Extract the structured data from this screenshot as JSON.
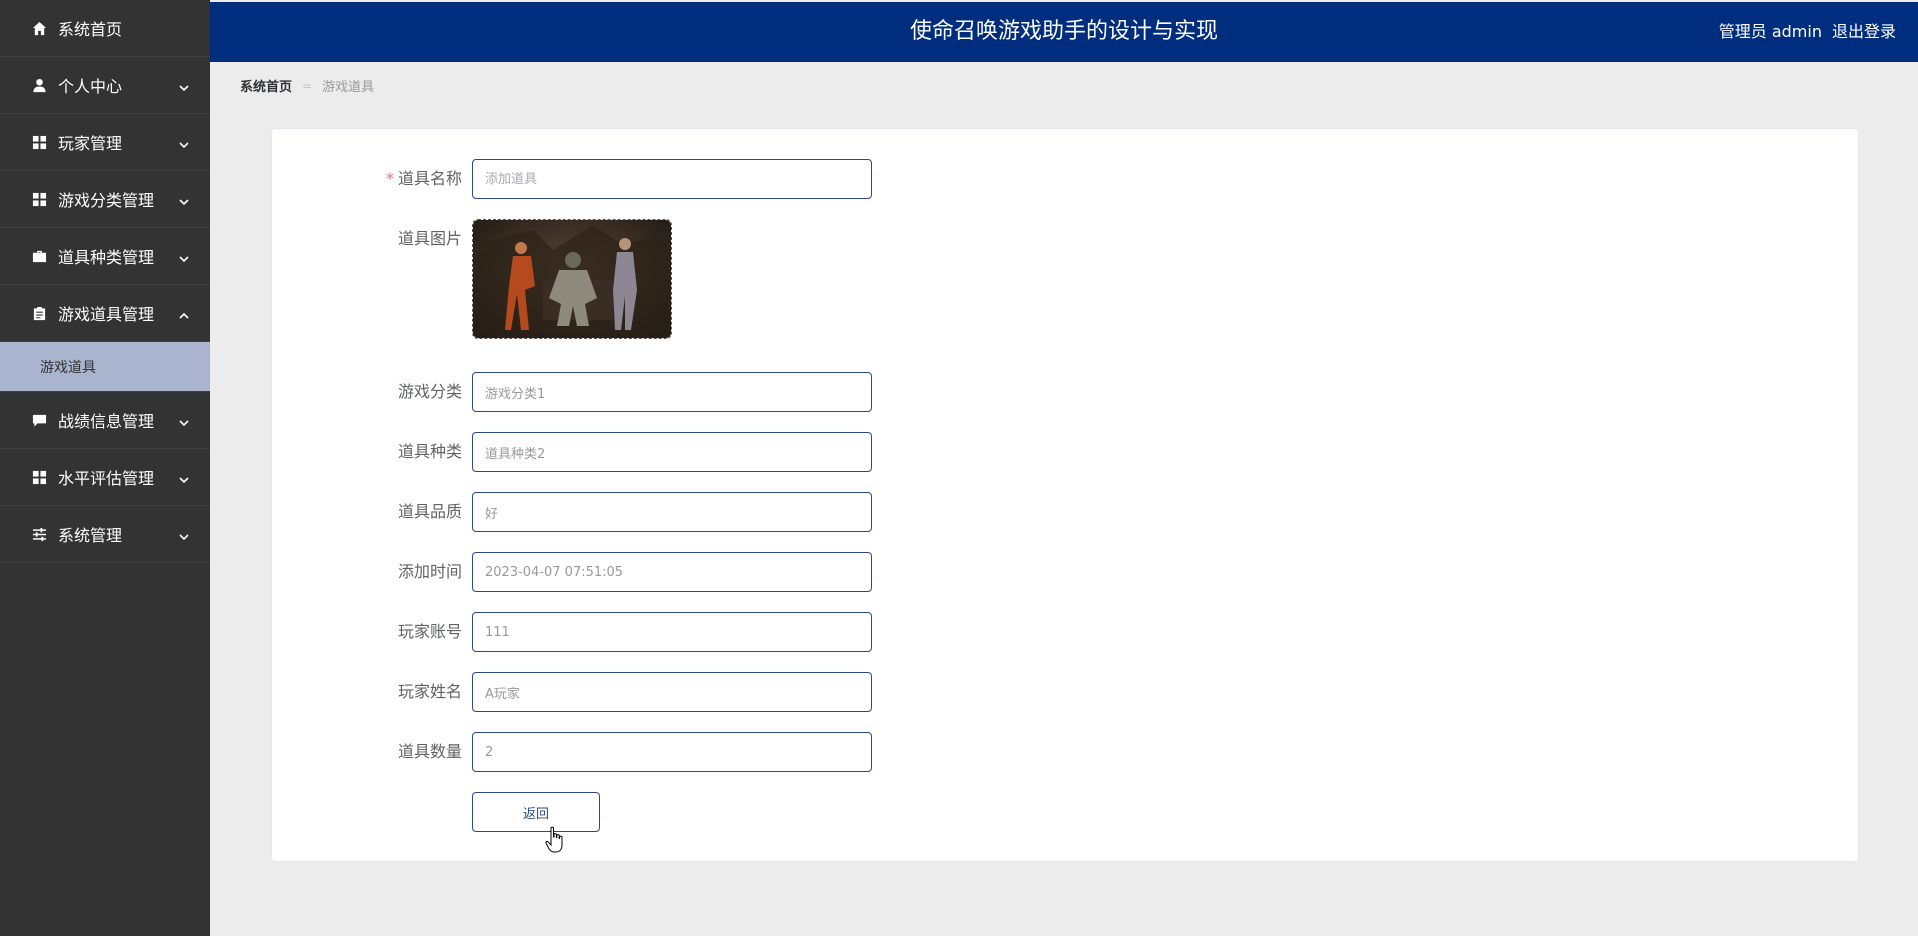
{
  "header": {
    "title": "使命召唤游戏助手的设计与实现",
    "user_label": "管理员 admin",
    "logout_label": "退出登录",
    "bg_color": "#012d7f"
  },
  "sidebar": {
    "items": [
      {
        "label": "系统首页",
        "icon": "home-icon",
        "has_children": false
      },
      {
        "label": "个人中心",
        "icon": "user-icon",
        "has_children": true
      },
      {
        "label": "玩家管理",
        "icon": "grid-icon",
        "has_children": true
      },
      {
        "label": "游戏分类管理",
        "icon": "grid-icon",
        "has_children": true
      },
      {
        "label": "道具种类管理",
        "icon": "briefcase-icon",
        "has_children": true
      },
      {
        "label": "游戏道具管理",
        "icon": "clipboard-icon",
        "has_children": true,
        "expanded": true
      },
      {
        "label": "战绩信息管理",
        "icon": "chat-icon",
        "has_children": true
      },
      {
        "label": "水平评估管理",
        "icon": "grid-icon",
        "has_children": true
      },
      {
        "label": "系统管理",
        "icon": "sliders-icon",
        "has_children": true
      }
    ],
    "submenu": {
      "label": "游戏道具"
    }
  },
  "breadcrumb": {
    "home": "系统首页",
    "separator": "=",
    "current": "游戏道具"
  },
  "form": {
    "name": {
      "label": "道具名称",
      "placeholder": "添加道具",
      "required": true
    },
    "image": {
      "label": "道具图片"
    },
    "category": {
      "label": "游戏分类",
      "value": "游戏分类1"
    },
    "type": {
      "label": "道具种类",
      "value": "道具种类2"
    },
    "quality": {
      "label": "道具品质",
      "value": "好"
    },
    "time": {
      "label": "添加时间",
      "value": "2023-04-07 07:51:05"
    },
    "account": {
      "label": "玩家账号",
      "value": "111"
    },
    "player_name": {
      "label": "玩家姓名",
      "value": "A玩家"
    },
    "quantity": {
      "label": "道具数量",
      "value": "2"
    },
    "back_label": "返回"
  }
}
